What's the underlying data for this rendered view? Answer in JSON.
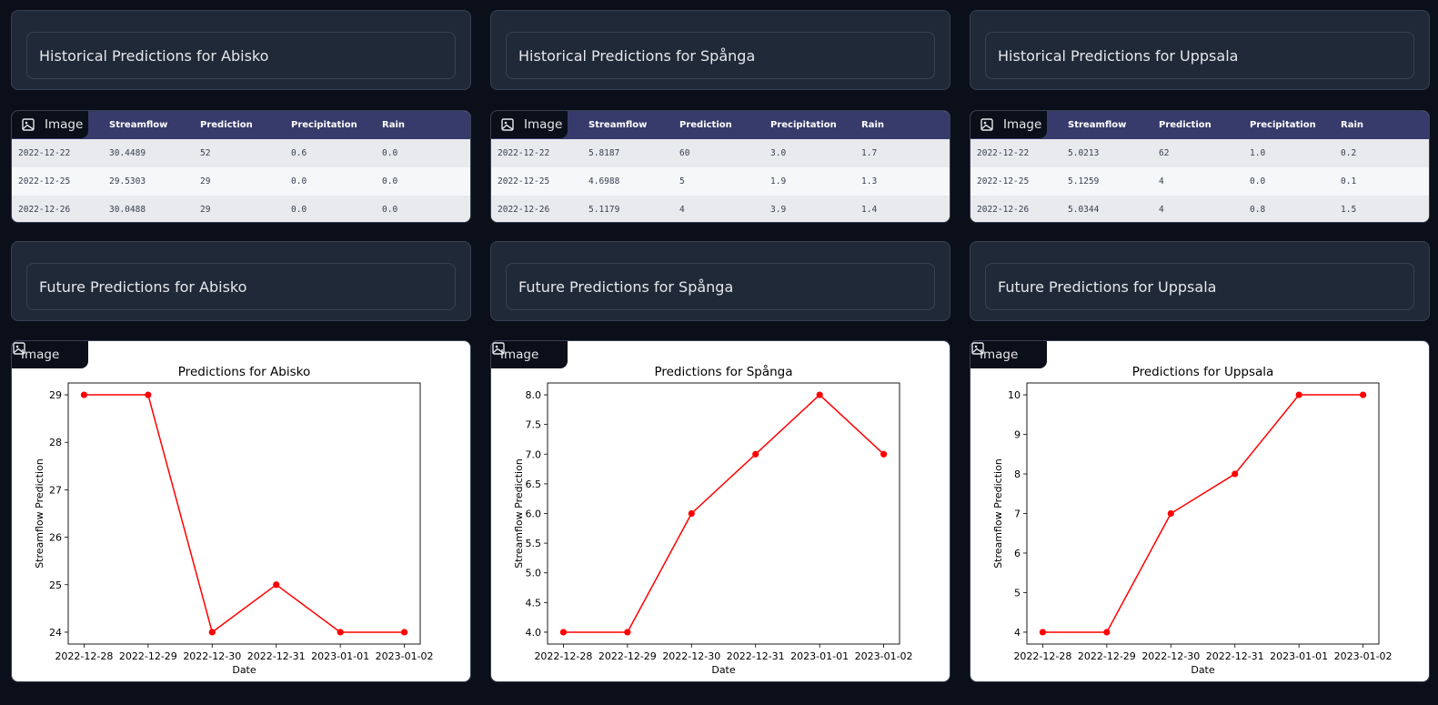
{
  "badge_label": "Image",
  "columns": [
    {
      "hist_title": "Historical Predictions for Abisko",
      "future_title": "Future Predictions for Abisko",
      "table": {
        "headers": [
          "",
          "Streamflow",
          "Prediction",
          "Precipitation",
          "Rain"
        ],
        "rows": [
          [
            "2022-12-22",
            "30.4489",
            "52",
            "0.6",
            "0.0"
          ],
          [
            "2022-12-25",
            "29.5303",
            "29",
            "0.0",
            "0.0"
          ],
          [
            "2022-12-26",
            "30.0488",
            "29",
            "0.0",
            "0.0"
          ]
        ]
      }
    },
    {
      "hist_title": "Historical Predictions for Spånga",
      "future_title": "Future Predictions for Spånga",
      "table": {
        "headers": [
          "",
          "Streamflow",
          "Prediction",
          "Precipitation",
          "Rain"
        ],
        "rows": [
          [
            "2022-12-22",
            "5.8187",
            "60",
            "3.0",
            "1.7"
          ],
          [
            "2022-12-25",
            "4.6988",
            "5",
            "1.9",
            "1.3"
          ],
          [
            "2022-12-26",
            "5.1179",
            "4",
            "3.9",
            "1.4"
          ]
        ]
      }
    },
    {
      "hist_title": "Historical Predictions for Uppsala",
      "future_title": "Future Predictions for Uppsala",
      "table": {
        "headers": [
          "",
          "Streamflow",
          "Prediction",
          "Precipitation",
          "Rain"
        ],
        "rows": [
          [
            "2022-12-22",
            "5.0213",
            "62",
            "1.0",
            "0.2"
          ],
          [
            "2022-12-25",
            "5.1259",
            "4",
            "0.0",
            "0.1"
          ],
          [
            "2022-12-26",
            "5.0344",
            "4",
            "0.8",
            "1.5"
          ]
        ]
      }
    }
  ],
  "chart_data": [
    {
      "type": "line",
      "title": "Predictions for Abisko",
      "xlabel": "Date",
      "ylabel": "Streamflow Prediction",
      "x": [
        "2022-12-28",
        "2022-12-29",
        "2022-12-30",
        "2022-12-31",
        "2023-01-01",
        "2023-01-02"
      ],
      "values": [
        29,
        29,
        24,
        25,
        24,
        24
      ],
      "yticks": [
        24,
        25,
        26,
        27,
        28,
        29
      ],
      "ylim": [
        23.75,
        29.25
      ],
      "color": "#ff0000"
    },
    {
      "type": "line",
      "title": "Predictions for Spånga",
      "xlabel": "Date",
      "ylabel": "Streamflow Prediction",
      "x": [
        "2022-12-28",
        "2022-12-29",
        "2022-12-30",
        "2022-12-31",
        "2023-01-01",
        "2023-01-02"
      ],
      "values": [
        4,
        4,
        6,
        7,
        8,
        7
      ],
      "yticks": [
        4.0,
        4.5,
        5.0,
        5.5,
        6.0,
        6.5,
        7.0,
        7.5,
        8.0
      ],
      "ytick_labels": [
        "4.0",
        "4.5",
        "5.0",
        "5.5",
        "6.0",
        "6.5",
        "7.0",
        "7.5",
        "8.0"
      ],
      "ylim": [
        3.8,
        8.2
      ],
      "color": "#ff0000"
    },
    {
      "type": "line",
      "title": "Predictions for Uppsala",
      "xlabel": "Date",
      "ylabel": "Streamflow Prediction",
      "x": [
        "2022-12-28",
        "2022-12-29",
        "2022-12-30",
        "2022-12-31",
        "2023-01-01",
        "2023-01-02"
      ],
      "values": [
        4,
        4,
        7,
        8,
        10,
        10
      ],
      "yticks": [
        4,
        5,
        6,
        7,
        8,
        9,
        10
      ],
      "ylim": [
        3.7,
        10.3
      ],
      "color": "#ff0000"
    }
  ]
}
